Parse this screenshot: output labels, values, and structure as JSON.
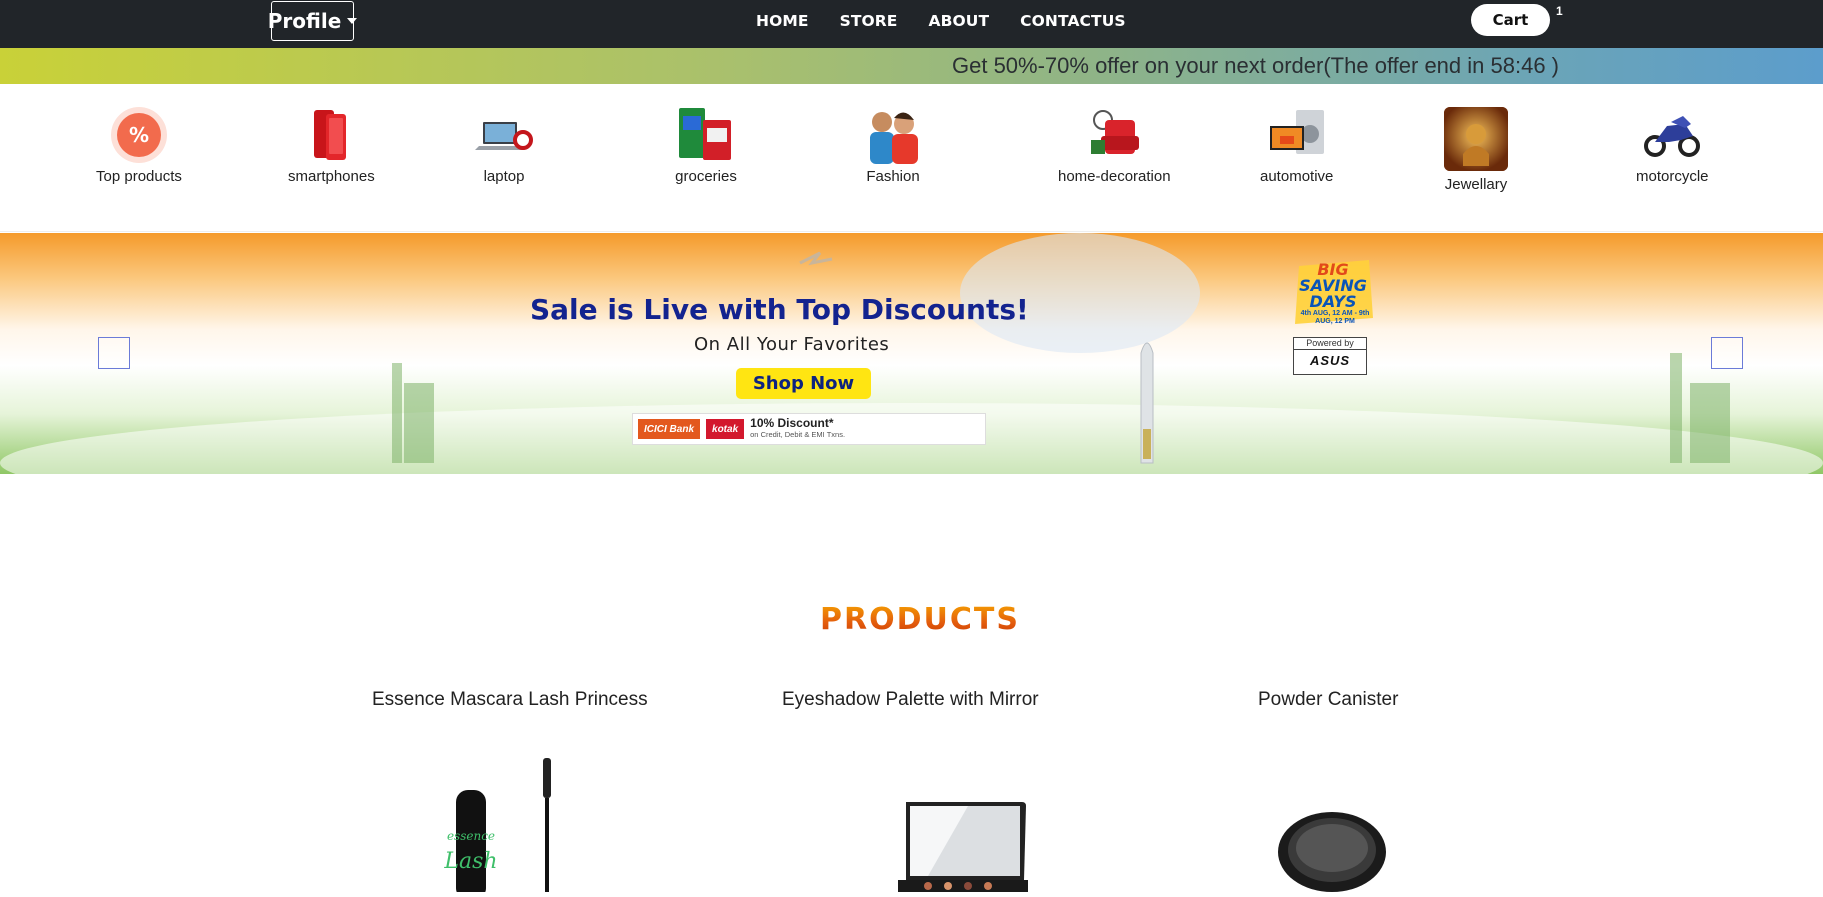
{
  "navbar": {
    "profile_label": "Profile",
    "links": [
      "HOME",
      "STORE",
      "ABOUT",
      "CONTACTUS"
    ],
    "cart_label": "Cart",
    "cart_count": "1"
  },
  "offer": {
    "text": "Get 50%-70% offer on your next order(The offer end in 58:46 )"
  },
  "categories": [
    {
      "label": "Top products",
      "icon": "percent-badge-icon"
    },
    {
      "label": "smartphones",
      "icon": "smartphone-icon"
    },
    {
      "label": "laptop",
      "icon": "laptop-icon"
    },
    {
      "label": "groceries",
      "icon": "groceries-icon"
    },
    {
      "label": "Fashion",
      "icon": "fashion-icon"
    },
    {
      "label": "home-decoration",
      "icon": "armchair-icon"
    },
    {
      "label": "automotive",
      "icon": "appliances-icon"
    },
    {
      "label": "Jewellary",
      "icon": "jewellery-icon"
    },
    {
      "label": "motorcycle",
      "icon": "motorcycle-icon"
    }
  ],
  "banner": {
    "title": "Sale is Live with Top Discounts!",
    "subtitle": "On All Your Favorites",
    "cta": "Shop Now",
    "bank1": "ICICI Bank",
    "bank2": "kotak",
    "discount": "10% Discount*",
    "discount_note": "on Credit, Debit & EMI Txns.",
    "bsd_line1": "BIG",
    "bsd_line2": "SAVING",
    "bsd_line3": "DAYS",
    "bsd_dates": "4th AUG, 12 AM - 9th AUG, 12 PM",
    "powered_by": "Powered by",
    "sponsor": "ASUS"
  },
  "products": {
    "heading": "PRODUCTS",
    "items": [
      {
        "name": "Essence Mascara Lash Princess",
        "icon": "mascara-icon"
      },
      {
        "name": "Eyeshadow Palette with Mirror",
        "icon": "eyeshadow-palette-icon"
      },
      {
        "name": "Powder Canister",
        "icon": "powder-canister-icon"
      }
    ]
  },
  "colors": {
    "navbar_bg": "#212529",
    "banner_title": "#13238f",
    "cta_bg": "#ffe512",
    "products_heading": "#e35b0d"
  }
}
